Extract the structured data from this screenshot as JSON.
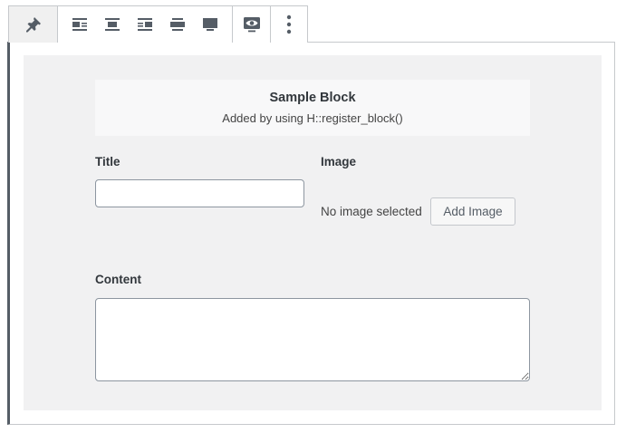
{
  "toolbar": {
    "icons": [
      "pin-icon",
      "align-left-icon",
      "align-center-icon",
      "align-right-icon",
      "align-wide-icon",
      "align-full-icon",
      "preview-eye-icon",
      "more-options-icon"
    ]
  },
  "block": {
    "title": "Sample Block",
    "subtitle": "Added by using H::register_block()"
  },
  "fields": {
    "title_label": "Title",
    "title_value": "",
    "image_label": "Image",
    "image_status": "No image selected",
    "add_image_label": "Add Image",
    "content_label": "Content",
    "content_value": ""
  },
  "colors": {
    "frame_accent": "#555d66",
    "panel_bg": "#f1f1f2",
    "header_bg": "#f8f8f9",
    "icon": "#555d66"
  }
}
